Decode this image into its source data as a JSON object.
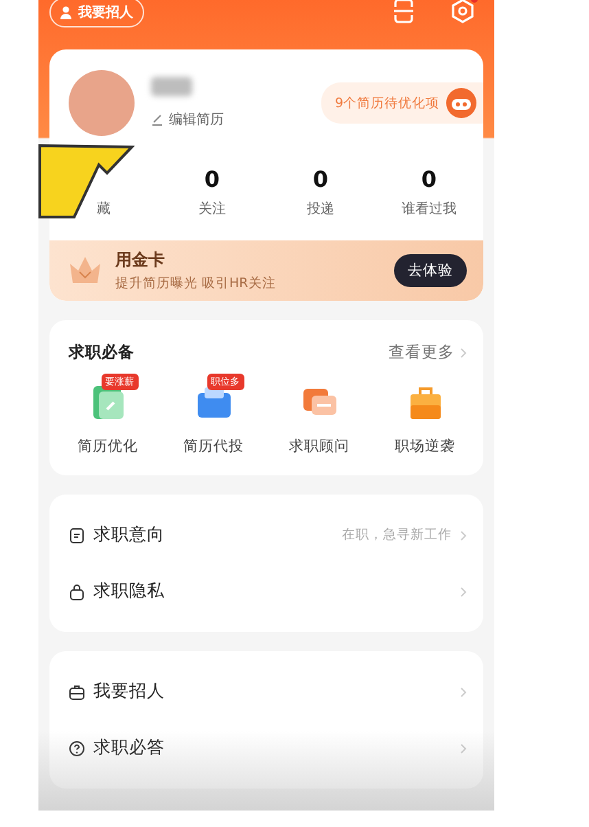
{
  "header": {
    "recruit_button": "我要招人",
    "settings_dot": true
  },
  "profile": {
    "edit_label": "编辑简历",
    "optimize_badge": "9个简历待优化项",
    "stats": [
      {
        "label": "藏"
      },
      {
        "value": "0",
        "label": "关注"
      },
      {
        "value": "0",
        "label": "投递"
      },
      {
        "value": "0",
        "label": "谁看过我"
      }
    ]
  },
  "gold_card": {
    "title": "用金卡",
    "subtitle": "提升简历曝光 吸引HR关注",
    "button": "去体验"
  },
  "tools": {
    "title": "求职必备",
    "more": "查看更多",
    "items": [
      {
        "kind": "resume",
        "label": "简历优化",
        "badge": "要涨薪"
      },
      {
        "kind": "delivery",
        "label": "简历代投",
        "badge": "职位多"
      },
      {
        "kind": "advisor",
        "label": "求职顾问"
      },
      {
        "kind": "career",
        "label": "职场逆袭"
      }
    ]
  },
  "menu_groups": [
    [
      {
        "kind": "intent",
        "label": "求职意向",
        "value": "在职，急寻新工作"
      },
      {
        "kind": "privacy",
        "label": "求职隐私"
      }
    ],
    [
      {
        "kind": "recruit",
        "label": "我要招人"
      },
      {
        "kind": "help",
        "label": "求职必答"
      }
    ]
  ]
}
